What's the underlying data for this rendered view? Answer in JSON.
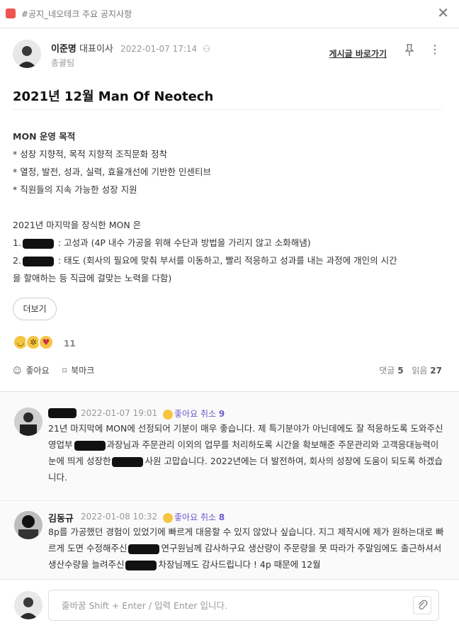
{
  "topbar": {
    "channel": "#공지_네오테크 주요 공지사항",
    "close": "✕"
  },
  "post": {
    "author_name": "이준명",
    "author_role": "대표이사",
    "date": "2022-01-07 17:14",
    "team": "총괄팀",
    "goto_label": "게시글 바로가기",
    "title": "2021년 12월 Man Of Neotech",
    "lines": [
      "MON 운영 목적",
      "* 성장 지향적, 목적 지향적 조직문화 정착",
      "* 열정, 발전, 성과, 실력, 효율개선에 기반한 인센티브",
      "* 직원들의 지속 가능한 성장 지원",
      "",
      "2021년 마지막을 장식한 MON 은",
      "1.",
      " : 고성과 (4P 내수 가공을 위해 수단과 방법을 가리지 않고 소화해냄)",
      "2.",
      " : 태도 (회사의 필요에 맞춰 부서를 이동하고, 빨리 적응하고 성과를 내는 과정에 개인의 시간",
      "을 할애하는 등 직급에 걸맞는 노력을 다함)"
    ],
    "more_label": "더보기",
    "reaction_count": "11",
    "like_label": "좋아요",
    "bookmark_label": "북마크",
    "comment_label": "댓글",
    "comment_count": "5",
    "read_label": "읽음",
    "read_count": "27"
  },
  "comments": [
    {
      "name": "",
      "date": "2022-01-07 19:01",
      "like_label": "좋아요",
      "cancel_label": "취소",
      "like_count": "9",
      "text_parts": [
        "21년 마지막에 MON에 선정되어 기분이 매우 좋습니다. 제 특기분야가 아닌데에도 잘 적응하도록 도와주신 영업부",
        "과장님과 주문관리 이외의 업무를 처리하도록 시간을 확보해준 주문관리와 고객응대능력이 눈에 띄게 성장한",
        "사원 고맙습니다. 2022년에는 더 발전하여, 회사의 성장에 도움이 되도록 하겠습니다."
      ]
    },
    {
      "name": "김동규",
      "date": "2022-01-08 10:32",
      "like_label": "좋아요",
      "cancel_label": "취소",
      "like_count": "8",
      "text_parts": [
        "8p를 가공했던 경험이 있었기에 빠르게 대응할 수 있지 않았나 싶습니다. 지그 제작시에 제가 원하는대로 빠르게 도면 수정해주신",
        "연구원님께 감사하구요 생산량이 주문량을 못 따라가 주말임에도 출근하셔서 생산수량을 늘려주신",
        "차장님께도 감사드립니다 ! 4p 때문에 12월"
      ]
    }
  ],
  "input": {
    "placeholder": "줄바꿈 Shift + Enter / 입력 Enter 입니다."
  }
}
